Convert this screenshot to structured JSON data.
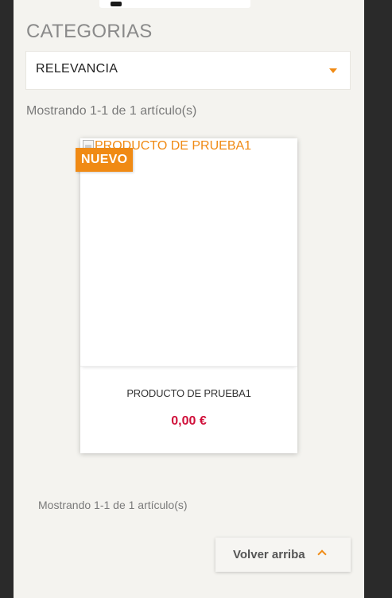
{
  "header": {
    "category_title": "CATEGORIAS"
  },
  "sort": {
    "selected": "RELEVANCIA"
  },
  "results": {
    "count_top": "Mostrando 1-1 de 1 artículo(s)",
    "count_bottom": "Mostrando 1-1 de 1 artículo(s)"
  },
  "product": {
    "image_alt": "PRODUCTO DE PRUEBA1",
    "badge": "NUEVO",
    "name": "PRODUCTO DE PRUEBA1",
    "price": "0,00 €"
  },
  "footer": {
    "back_to_top": "Volver arriba"
  },
  "colors": {
    "accent": "#f08a14",
    "price": "#d0103a",
    "page_bg": "#f4f3ef",
    "frame_bg": "#2a2a2a"
  },
  "icons": {
    "sort_caret": "caret-down-icon",
    "back_to_top": "chevron-up-icon",
    "broken_image": "broken-image-icon"
  }
}
